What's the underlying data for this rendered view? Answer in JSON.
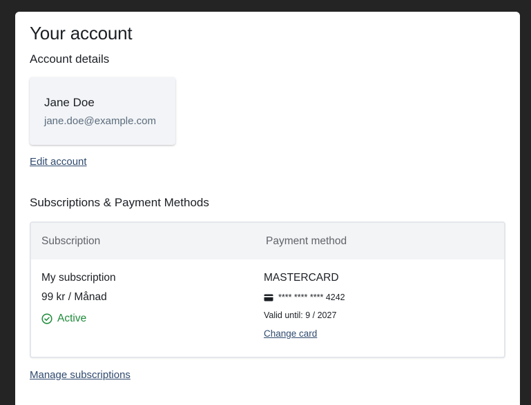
{
  "page": {
    "title": "Your account"
  },
  "account": {
    "section_title": "Account details",
    "name": "Jane Doe",
    "email": "jane.doe@example.com",
    "edit_link": "Edit account"
  },
  "subscriptions": {
    "section_title": "Subscriptions & Payment Methods",
    "columns": [
      "Subscription",
      "Payment method"
    ],
    "rows": [
      {
        "name": "My subscription",
        "price": "99 kr / Månad",
        "status": "Active",
        "status_color": "#1e8a3a",
        "status_icon": "check-circle-icon",
        "card_brand": "MASTERCARD",
        "card_icon": "credit-card-icon",
        "card_number": "**** **** **** 4242",
        "valid_until": "Valid until: 9 / 2027",
        "change_card": "Change card"
      }
    ],
    "manage_link": "Manage subscriptions"
  },
  "colors": {
    "background": "#242424",
    "panel": "#ffffff",
    "link": "#2f4a6e",
    "active": "#1e8a3a"
  }
}
